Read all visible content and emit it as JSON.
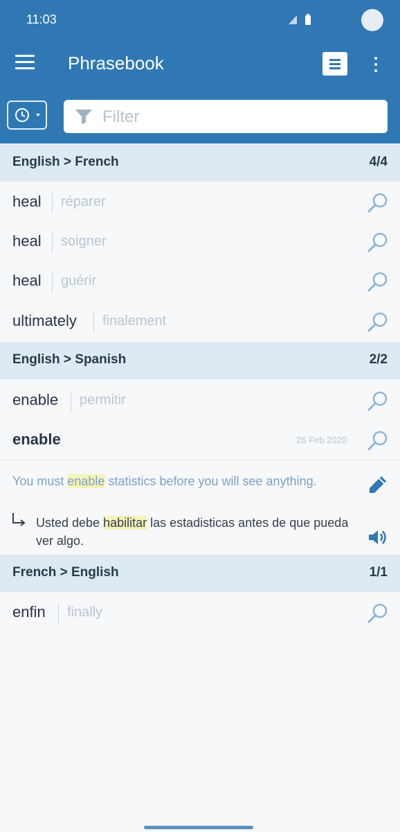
{
  "status_bar": {
    "time": "11:03"
  },
  "app_bar": {
    "title": "Phrasebook"
  },
  "filter": {
    "placeholder": "Filter"
  },
  "groups": [
    {
      "title": "English > French",
      "count": "4/4",
      "entries": [
        {
          "term": "heal",
          "translation": "réparer"
        },
        {
          "term": "heal",
          "translation": "soigner"
        },
        {
          "term": "heal",
          "translation": "guérir"
        },
        {
          "term": "ultimately",
          "translation": "finalement"
        }
      ]
    },
    {
      "title": "English > Spanish",
      "count": "2/2",
      "entries": [
        {
          "term": "enable",
          "translation": "permitir"
        },
        {
          "term": "enable",
          "date": "26 Feb 2020",
          "example": {
            "en_before": "You must ",
            "en_highlight": "enable",
            "en_after": " statistics before you will see anything.",
            "es_before": "Usted debe ",
            "es_highlight": "habilitar",
            "es_after": " las estadisticas antes de que pueda ver algo."
          }
        }
      ]
    },
    {
      "title": "French > English",
      "count": "1/1",
      "entries": [
        {
          "term": "enfin",
          "translation": "finally"
        }
      ]
    }
  ],
  "colors": {
    "app_bar": "#2f78b4",
    "group_header": "#dde9f3",
    "highlight": "#f5f3b7"
  }
}
